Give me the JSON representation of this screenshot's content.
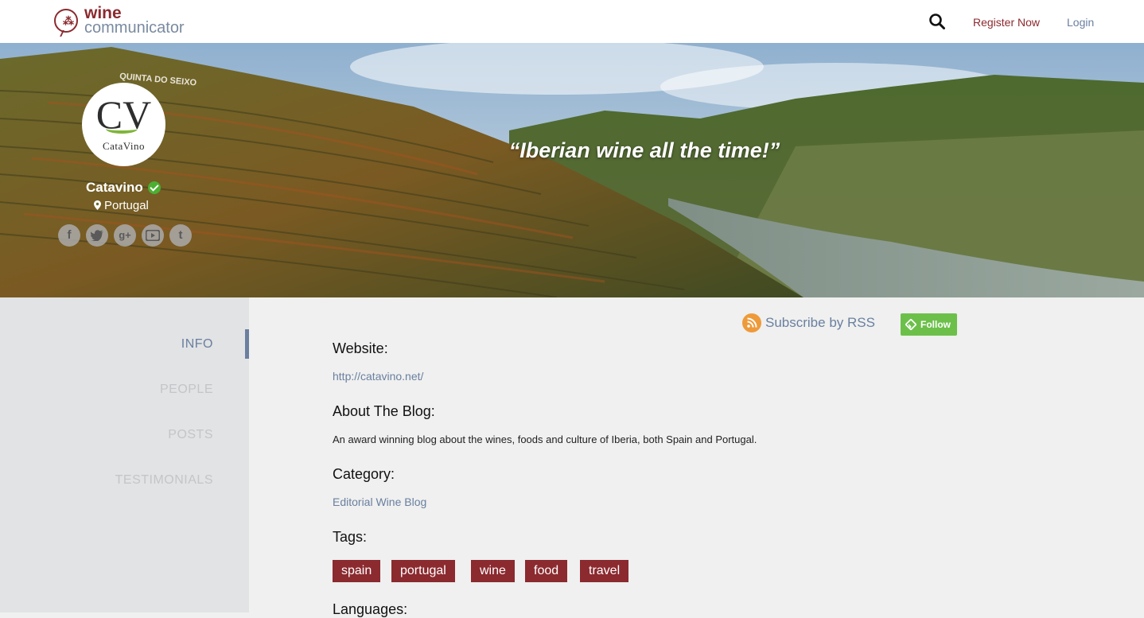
{
  "header": {
    "logo_wine": "wine",
    "logo_communicator": "communicator",
    "register_label": "Register Now",
    "login_label": "Login"
  },
  "hero": {
    "badge_cv": "CV",
    "badge_name": "CataVino",
    "photo_sign": "QUINTA DO SEIXO",
    "tagline": "“Iberian wine all the time!”",
    "profile_name": "Catavino",
    "location": "Portugal",
    "social_icons": [
      "facebook-icon",
      "twitter-icon",
      "google-plus-icon",
      "youtube-icon",
      "tumblr-icon"
    ]
  },
  "sidebar": {
    "items": [
      {
        "label": "INFO",
        "active": true
      },
      {
        "label": "PEOPLE",
        "active": false
      },
      {
        "label": "POSTS",
        "active": false
      },
      {
        "label": "TESTIMONIALS",
        "active": false
      }
    ]
  },
  "main": {
    "rss_label": "Subscribe by RSS",
    "follow_label": "Follow",
    "website_label": "Website:",
    "website_url": "http://catavino.net/",
    "about_label": "About The Blog:",
    "about_text": "An award winning blog about the wines, foods and culture of Iberia, both Spain and Portugal.",
    "category_label": "Category:",
    "category_value": "Editorial Wine Blog",
    "tags_label": "Tags:",
    "tags": [
      "spain",
      "portugal",
      "wine",
      "food",
      "travel"
    ],
    "languages_label": "Languages:"
  },
  "colors": {
    "brand": "#8b2a2f",
    "link": "#6a7fa0",
    "follow": "#6cc04a",
    "rss": "#ee9a3a",
    "verified": "#4caf32"
  }
}
